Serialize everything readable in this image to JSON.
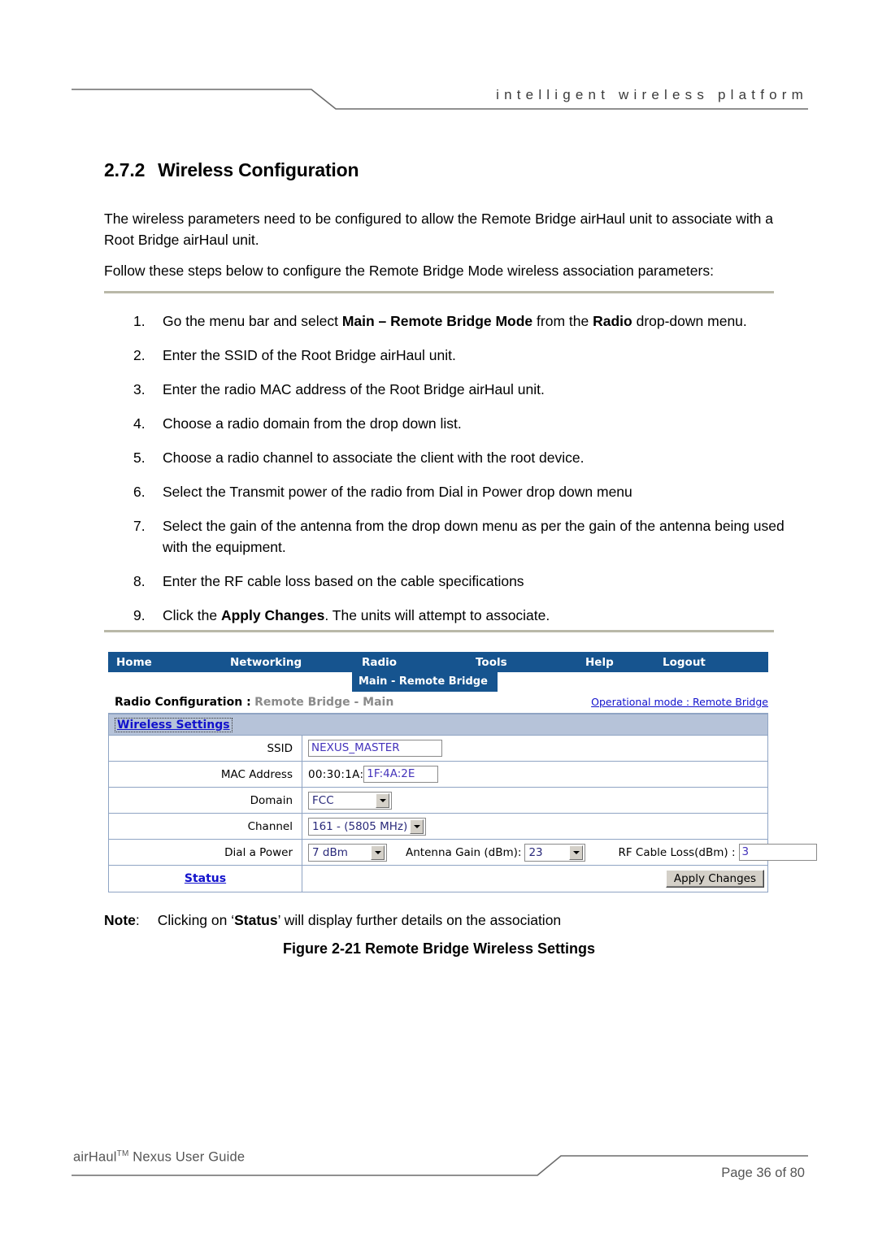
{
  "header": {
    "tagline": "intelligent wireless platform"
  },
  "section": {
    "number": "2.7.2",
    "title": "Wireless Configuration"
  },
  "intro": {
    "paragraph_1": "The wireless parameters need to be configured to allow the Remote Bridge airHaul unit to associate with a Root Bridge airHaul unit.",
    "paragraph_2": "Follow these steps below to configure the Remote Bridge Mode wireless association parameters:"
  },
  "steps": [
    {
      "marker": "1.",
      "html": "Go the menu bar and select <b>Main &ndash; Remote Bridge Mode</b> from the <b>Radio</b> drop-down menu."
    },
    {
      "marker": "2.",
      "html": "Enter the SSID of the Root Bridge airHaul unit."
    },
    {
      "marker": "3.",
      "html": "Enter the radio MAC address of the Root Bridge airHaul unit."
    },
    {
      "marker": "4.",
      "html": "Choose a radio domain from the drop down list."
    },
    {
      "marker": "5.",
      "html": "Choose a radio channel to associate the client with the root device."
    },
    {
      "marker": "6.",
      "html": "Select the Transmit power of the radio from Dial in Power drop down menu"
    },
    {
      "marker": "7.",
      "html": "Select the gain of the antenna from the drop down menu as per the gain of the antenna being used with the equipment."
    },
    {
      "marker": "8.",
      "html": "Enter the RF cable loss based on the cable specifications"
    },
    {
      "marker": "9.",
      "html": "Click the <b>Apply Changes</b>. The units will attempt to associate."
    }
  ],
  "screenshot": {
    "nav": {
      "home": "Home",
      "networking": "Networking",
      "radio": "Radio",
      "tools": "Tools",
      "help": "Help",
      "logout": "Logout",
      "submenu": "Main - Remote Bridge",
      "bar_color": "#16548f"
    },
    "title": {
      "strong": "Radio Configuration :",
      "light": "Remote Bridge - Main",
      "operational_mode": "Operational mode : Remote Bridge"
    },
    "panel": {
      "heading": "Wireless Settings",
      "heading_color": "#1111cc",
      "header_band_color": "#b6c3d9",
      "border_color": "#8fa4c4",
      "rows": {
        "ssid": {
          "label": "SSID",
          "value": "NEXUS_MASTER"
        },
        "mac": {
          "label": "MAC Address",
          "prefix": "00:30:1A:",
          "value": "1F:4A:2E"
        },
        "domain": {
          "label": "Domain",
          "value": "FCC"
        },
        "channel": {
          "label": "Channel",
          "value": "161 - (5805 MHz)"
        },
        "power": {
          "label": "Dial a Power",
          "value": "7 dBm",
          "gain_label": "Antenna Gain (dBm):",
          "gain_value": "23",
          "cableloss_label": "RF Cable Loss(dBm) :",
          "cableloss_value": "3"
        },
        "footer": {
          "status_link": "Status",
          "apply_button": "Apply Changes"
        }
      }
    }
  },
  "note": {
    "label": "Note",
    "colon": ":",
    "text_before": "Clicking on ‘",
    "bold_word": "Status",
    "text_after": "’ will display further details on the association"
  },
  "figure": {
    "caption": "Figure 2-21 Remote Bridge Wireless Settings"
  },
  "footer": {
    "guide_name_1": "airHaul",
    "guide_tm": "TM",
    "guide_name_2": " Nexus User Guide",
    "page_label": "Page 36 of 80"
  }
}
